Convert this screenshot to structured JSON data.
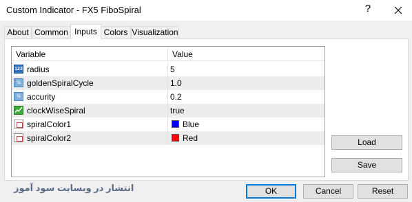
{
  "window": {
    "title": "Custom Indicator - FX5 FiboSpiral",
    "help_label": "?",
    "close_label": "X"
  },
  "tabs": [
    {
      "label": "About",
      "active": false
    },
    {
      "label": "Common",
      "active": false
    },
    {
      "label": "Inputs",
      "active": true
    },
    {
      "label": "Colors",
      "active": false
    },
    {
      "label": "Visualization",
      "active": false
    }
  ],
  "grid": {
    "headers": {
      "variable": "Variable",
      "value": "Value"
    },
    "rows": [
      {
        "icon": "int-icon",
        "icon_text": "123",
        "name": "radius",
        "value": "5"
      },
      {
        "icon": "double-icon",
        "icon_text": "½",
        "name": "goldenSpiralCycle",
        "value": "1.0"
      },
      {
        "icon": "double-icon",
        "icon_text": "½",
        "name": "accurity",
        "value": "0.2"
      },
      {
        "icon": "bool-icon",
        "icon_text": "",
        "name": "clockWiseSpiral",
        "value": "true"
      },
      {
        "icon": "color-icon",
        "icon_text": "",
        "name": "spiralColor1",
        "value": "Blue",
        "swatch": "#0000ff"
      },
      {
        "icon": "color-icon",
        "icon_text": "",
        "name": "spiralColor2",
        "value": "Red",
        "swatch": "#ff0000"
      }
    ]
  },
  "side_buttons": {
    "load": "Load",
    "save": "Save"
  },
  "footer_buttons": {
    "ok": "OK",
    "cancel": "Cancel",
    "reset": "Reset"
  },
  "watermark": "انتشار در وبسایت سود آموز",
  "colors": {
    "accent": "#0078d7",
    "blue": "#0000ff",
    "red": "#ff0000"
  }
}
